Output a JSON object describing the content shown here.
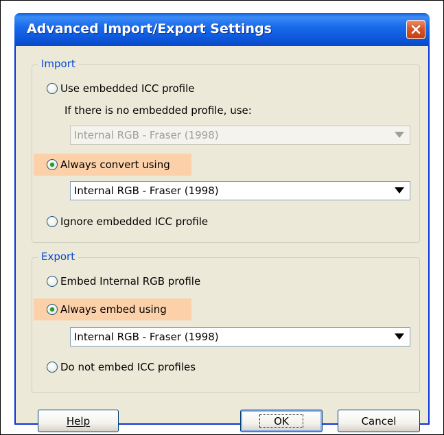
{
  "dialog": {
    "title": "Advanced Import/Export Settings"
  },
  "import": {
    "legend": "Import",
    "use_embedded_label": "Use embedded ICC profile",
    "no_profile_hint": "If there is no embedded profile, use:",
    "fallback_profile_value": "Internal RGB - Fraser (1998)",
    "always_convert_label": "Always convert using",
    "convert_profile_value": "Internal RGB - Fraser (1998)",
    "ignore_embedded_label": "Ignore embedded ICC profile",
    "selected": "always_convert"
  },
  "export": {
    "legend": "Export",
    "embed_internal_label": "Embed Internal RGB profile",
    "always_embed_label": "Always embed using",
    "embed_profile_value": "Internal RGB - Fraser (1998)",
    "do_not_embed_label": "Do not embed ICC profiles",
    "selected": "always_embed"
  },
  "buttons": {
    "help": "Help",
    "ok": "OK",
    "cancel": "Cancel"
  },
  "colors": {
    "titlebar": "#0a5fe8",
    "dialog_bg": "#ece9d8",
    "highlight": "#fcd0a8",
    "legend_text": "#0046d5",
    "radio_dot": "#21a121"
  }
}
